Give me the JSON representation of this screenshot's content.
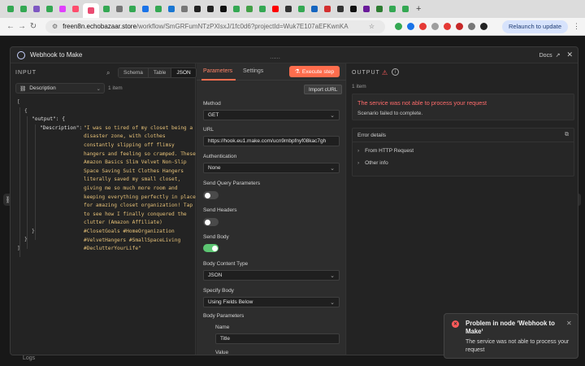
{
  "browser": {
    "tabs": [
      {
        "name": "tab-sheets",
        "color": "#34a853"
      },
      {
        "name": "tab-sheets",
        "color": "#34a853"
      },
      {
        "name": "tab-forms",
        "color": "#7e57c2"
      },
      {
        "name": "tab-sheets",
        "color": "#34a853"
      },
      {
        "name": "tab-make",
        "color": "#e040fb",
        "label": "sk"
      },
      {
        "name": "tab-make",
        "color": "#ff4d6d"
      },
      {
        "name": "tab-n8n",
        "color": "#ea4b71",
        "active": true
      },
      {
        "name": "tab-sheets",
        "color": "#34a853"
      },
      {
        "name": "tab-gear",
        "color": "#777777"
      },
      {
        "name": "tab-sheets",
        "color": "#34a853"
      },
      {
        "name": "tab-blue",
        "color": "#1a73e8"
      },
      {
        "name": "tab-sheets",
        "color": "#34a853"
      },
      {
        "name": "tab-bluetext",
        "color": "#1976d2"
      },
      {
        "name": "tab-gear",
        "color": "#777777"
      },
      {
        "name": "tab-github",
        "color": "#222222"
      },
      {
        "name": "tab-github",
        "color": "#222222"
      },
      {
        "name": "tab-black",
        "color": "#111111"
      },
      {
        "name": "tab-sheets",
        "color": "#34a853"
      },
      {
        "name": "tab-green",
        "color": "#43a047"
      },
      {
        "name": "tab-sheets",
        "color": "#34a853"
      },
      {
        "name": "tab-youtube",
        "color": "#ff0000"
      },
      {
        "name": "tab-dark",
        "color": "#333333"
      },
      {
        "name": "tab-sheets",
        "color": "#34a853"
      },
      {
        "name": "tab-blue",
        "color": "#1565c0"
      },
      {
        "name": "tab-red",
        "color": "#d32f2f"
      },
      {
        "name": "tab-dark",
        "color": "#333333"
      },
      {
        "name": "tab-black",
        "color": "#111111"
      },
      {
        "name": "tab-purple",
        "color": "#6a1b9a"
      },
      {
        "name": "tab-green",
        "color": "#2e7d32"
      },
      {
        "name": "tab-sheets",
        "color": "#34a853"
      },
      {
        "name": "tab-sheets",
        "color": "#34a853"
      }
    ],
    "url_host": "freen8n.echobazaar.store",
    "url_path": "/workflow/SmGRFumNTzPXlsxJ/1fc0d6?projectId=Wuk7E107aEFKwnKA",
    "relaunch": "Relaunch to update",
    "ext_colors": [
      "#34a853",
      "#1a73e8",
      "#e53935",
      "#9e9e9e",
      "#e53935",
      "#c62828",
      "#777777",
      "#222222"
    ]
  },
  "modal": {
    "title": "Webhook to Make",
    "docs": "Docs"
  },
  "input": {
    "label": "INPUT",
    "tabs": [
      "Schema",
      "Table",
      "JSON"
    ],
    "active_tab": "JSON",
    "field": "Description",
    "count": "1 item",
    "json_open": "[",
    "obj_open": "{",
    "output_key": "\"output\": {",
    "desc_key": "\"Description\":",
    "desc_value": "\"I was so tired of my closet being a disaster zone, with clothes constantly slipping off flimsy hangers and feeling so cramped. These Amazon Basics Slim Velvet Non-Slip Space Saving Suit Clothes Hangers literally saved my small closet, giving me so much more room and keeping everything perfectly in place for amazing closet organization! Tap to see how I finally conquered the clutter (Amazon Affiliate) #ClosetGoals #HomeOrganization #VelvetHangers #SmallSpaceLiving #DeclutterYourLife\"",
    "close_inner": "}",
    "close_obj": "}",
    "close_arr": "]"
  },
  "params": {
    "tab_parameters": "Parameters",
    "tab_settings": "Settings",
    "execute": "Execute step",
    "import_curl": "Import cURL",
    "method_label": "Method",
    "method_value": "GET",
    "url_label": "URL",
    "url_value": "https://hook.eu1.make.com/ucn9mbpfnyf08kac7gh",
    "auth_label": "Authentication",
    "auth_value": "None",
    "query_label": "Send Query Parameters",
    "query_on": false,
    "headers_label": "Send Headers",
    "headers_on": false,
    "body_label": "Send Body",
    "body_on": true,
    "content_type_label": "Body Content Type",
    "content_type_value": "JSON",
    "specify_label": "Specify Body",
    "specify_value": "Using Fields Below",
    "body_params_label": "Body Parameters",
    "name_label": "Name",
    "name_value": "Title",
    "value_label": "Value"
  },
  "output": {
    "label": "OUTPUT",
    "count": "1 item",
    "error_title": "The service was not able to process your request",
    "error_sub": "Scenario failed to complete.",
    "details_title": "Error details",
    "detail_items": [
      "From HTTP Request",
      "Other info"
    ]
  },
  "toast": {
    "title": "Problem in node ‘Webhook to Make‘",
    "body": "The service was not able to process your request"
  },
  "background": {
    "logs": "Logs"
  }
}
